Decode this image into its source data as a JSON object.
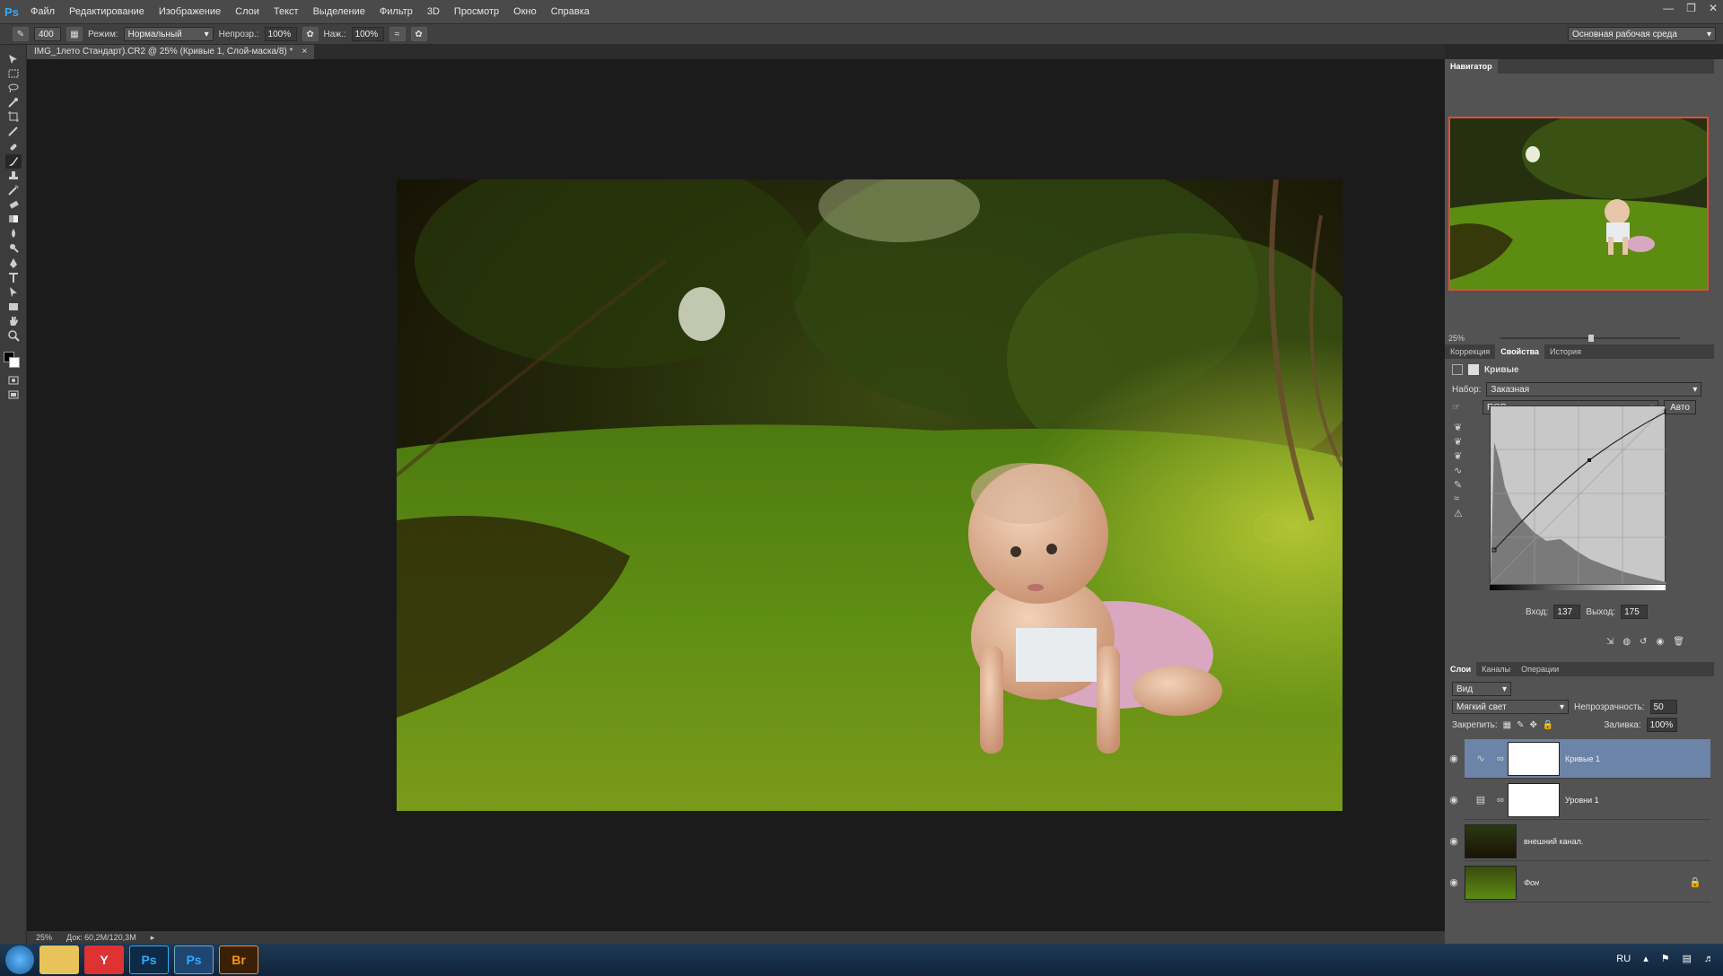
{
  "app": {
    "logo": "Ps"
  },
  "menu": [
    "Файл",
    "Редактирование",
    "Изображение",
    "Слои",
    "Текст",
    "Выделение",
    "Фильтр",
    "3D",
    "Просмотр",
    "Окно",
    "Справка"
  ],
  "options": {
    "brush_size": "400",
    "mode_label": "Режим:",
    "mode_value": "Нормальный",
    "opacity_label": "Непрозр.:",
    "opacity_value": "100%",
    "pressure_label": "Наж.:",
    "pressure_value": "100%",
    "workspace": "Основная рабочая среда"
  },
  "document": {
    "tab_title": "IMG_1лето Стандарт).CR2 @ 25% (Кривые 1, Слой-маска/8) *",
    "close": "×"
  },
  "status": {
    "zoom": "25%",
    "doc_info": "Док: 60,2M/120,3M"
  },
  "navigator": {
    "title": "Навигатор",
    "zoom": "25%"
  },
  "properties": {
    "tabs": [
      "Коррекция",
      "Свойства",
      "История"
    ],
    "active_tab": "Свойства",
    "panel_title": "Кривые",
    "preset_label": "Набор:",
    "preset_value": "Заказная",
    "channel_value": "RGB",
    "auto_button": "Авто",
    "input_label": "Вход:",
    "input_value": "137",
    "output_label": "Выход:",
    "output_value": "175"
  },
  "layers": {
    "tabs": [
      "Слои",
      "Каналы",
      "Операции"
    ],
    "active_tab": "Слои",
    "filter_value": "Вид",
    "blend_mode": "Мягкий свет",
    "opacity_label": "Непрозрачность:",
    "opacity_value": "50",
    "lock_label": "Закрепить:",
    "fill_label": "Заливка:",
    "fill_value": "100%",
    "items": [
      {
        "name": "Кривые 1",
        "type": "curves",
        "selected": true
      },
      {
        "name": "Уровни 1",
        "type": "levels",
        "selected": false
      },
      {
        "name": "внешний канал.",
        "type": "image",
        "selected": false
      },
      {
        "name": "Фон",
        "type": "background",
        "selected": false
      }
    ]
  },
  "taskbar": {
    "apps": [
      "start-orb",
      "explorer",
      "yandex",
      "photoshop",
      "photoshop-active",
      "bridge"
    ],
    "language": "RU"
  },
  "colors": {
    "accent_selected_layer": "#6c84a8",
    "navigator_frame": "#e04b3c",
    "ps_blue": "#31a8ff"
  }
}
